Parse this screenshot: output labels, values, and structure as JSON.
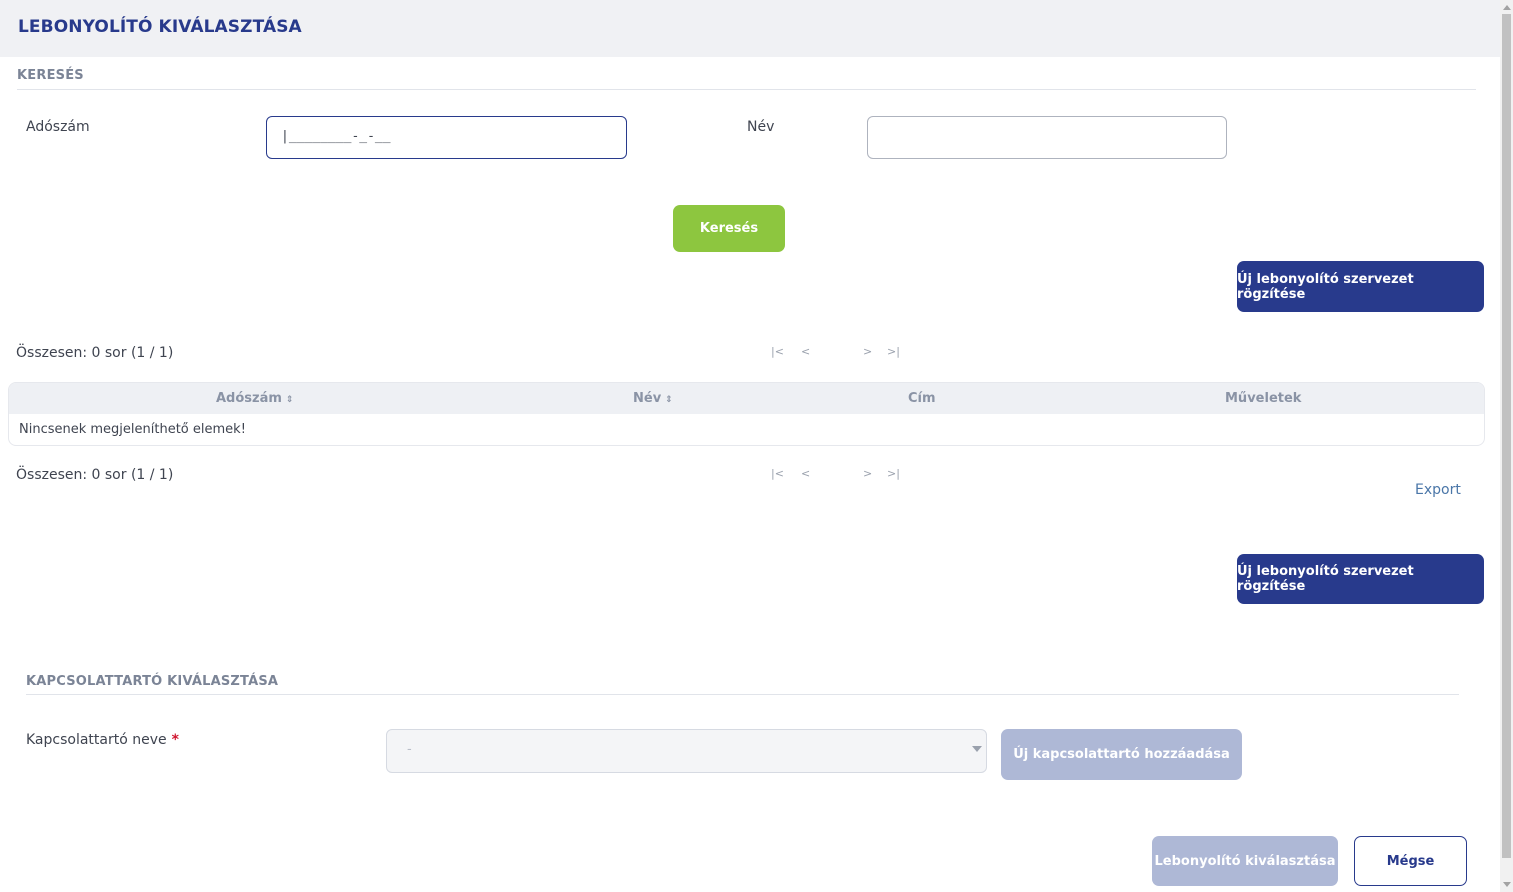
{
  "dialog": {
    "title": "LEBONYOLÍTÓ KIVÁLASZTÁSA"
  },
  "search": {
    "section_title": "KERESÉS",
    "tax_label": "Adószám",
    "tax_mask": "|________-_-__",
    "name_label": "Név",
    "name_value": "",
    "search_button": "Keresés"
  },
  "new_org_button": "Új lebonyolító szervezet rögzítése",
  "results": {
    "count_text": "Összesen: 0 sor (1 / 1)",
    "pager": {
      "first": "|<",
      "prev": "<",
      "next": ">",
      "last": ">|"
    },
    "columns": [
      {
        "label": "Adószám",
        "sortable": true
      },
      {
        "label": "Név",
        "sortable": true
      },
      {
        "label": "Cím",
        "sortable": false
      },
      {
        "label": "Műveletek",
        "sortable": false
      }
    ],
    "empty_message": "Nincsenek megjeleníthető elemek!",
    "export_link": "Export"
  },
  "contact": {
    "section_title": "KAPCSOLATTARTÓ KIVÁLASZTÁSA",
    "label": "Kapcsolattartó neve",
    "required_mark": "*",
    "select_value": "-",
    "add_button": "Új kapcsolattartó hozzáadása"
  },
  "footer": {
    "select_button": "Lebonyolító kiválasztása",
    "cancel_button": "Mégse"
  },
  "colors": {
    "brand_navy": "#283a8c",
    "search_green": "#8dc63f",
    "disabled_button": "#aeb8d6",
    "required_red": "#d0152f",
    "link_blue": "#4a76a8"
  }
}
